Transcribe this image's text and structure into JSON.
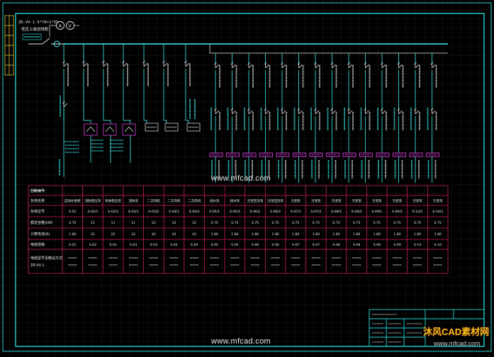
{
  "drawing": {
    "header_line1": "ZR-VV-1-5*70+1*35",
    "header_line2": "低压上级进线柜"
  },
  "watermarks": {
    "center": "www.mfcad.com",
    "bottom": "www.mfcad.com",
    "logo": "沐风CAD素材网",
    "logo_url": "www.mfcad.com"
  },
  "colors": {
    "background": "#000000",
    "frame": "#22d3d3",
    "busbar": "#3ff0f0",
    "breaker": "#e9e9e9",
    "table_grid": "#c8224a",
    "table_text": "#e8e8e8",
    "load_box": "#c83ac8",
    "meter_box": "#e9e9e9",
    "grid": "#1a1a1a"
  },
  "table": {
    "row_headers": [
      "回路编号",
      "负荷名称",
      "负荷位号",
      "额定容量(kW)",
      "计算电流(A)",
      "电缆规格",
      "电缆型号及敷设方式",
      "ZR-VV-1"
    ],
    "columns": [
      {
        "name": "自动补偿柜",
        "code": "S-01",
        "kw": "0.75",
        "a": "1.80",
        "cable": "S-01"
      },
      {
        "name": "消防稳压泵",
        "code": "S-02/1",
        "kw": "11",
        "a": "22",
        "cable": "S-02"
      },
      {
        "name": "喷淋稳压泵",
        "code": "S-02/2",
        "kw": "11",
        "a": "22",
        "cable": "S-02"
      },
      {
        "name": "消防泵",
        "code": "S-03/1",
        "kw": "11",
        "a": "22",
        "cable": "S-03"
      },
      {
        "name": "二次风机",
        "code": "S-03/2",
        "kw": "22",
        "a": "42",
        "cable": "S-03"
      },
      {
        "name": "二次风机",
        "code": "S-04/1",
        "kw": "22",
        "a": "42",
        "cable": "S-04"
      },
      {
        "name": "二次风机",
        "code": "S-04/2",
        "kw": "22",
        "a": "42",
        "cable": "S-04"
      },
      {
        "name": "排水泵",
        "code": "S-05/1",
        "kw": "0.75",
        "a": "1.80",
        "cable": "S-05"
      },
      {
        "name": "排水泵",
        "code": "S-05/2",
        "kw": "0.75",
        "a": "1.80",
        "cable": "S-05"
      },
      {
        "name": "污泥回流泵",
        "code": "S-06/1",
        "kw": "0.75",
        "a": "1.80",
        "cable": "S-06"
      },
      {
        "name": "污泥回流泵",
        "code": "S-06/2",
        "kw": "0.75",
        "a": "1.80",
        "cable": "S-06"
      },
      {
        "name": "污泥泵",
        "code": "S-07/1",
        "kw": "0.75",
        "a": "1.80",
        "cable": "S-07"
      },
      {
        "name": "污泥泵",
        "code": "S-07/2",
        "kw": "0.75",
        "a": "1.80",
        "cable": "S-07"
      },
      {
        "name": "污泥泵",
        "code": "S-08/1",
        "kw": "0.75",
        "a": "1.80",
        "cable": "S-08"
      },
      {
        "name": "污泥泵",
        "code": "S-08/2",
        "kw": "0.75",
        "a": "1.80",
        "cable": "S-08"
      },
      {
        "name": "污泥泵",
        "code": "S-09/1",
        "kw": "0.75",
        "a": "1.80",
        "cable": "S-09"
      },
      {
        "name": "污泥泵",
        "code": "S-09/2",
        "kw": "0.75",
        "a": "1.80",
        "cable": "S-09"
      },
      {
        "name": "污泥泵",
        "code": "S-10/1",
        "kw": "0.75",
        "a": "1.80",
        "cable": "S-10"
      },
      {
        "name": "污泥泵",
        "code": "S-10/2",
        "kw": "0.75",
        "a": "1.80",
        "cable": "S-10"
      }
    ]
  }
}
